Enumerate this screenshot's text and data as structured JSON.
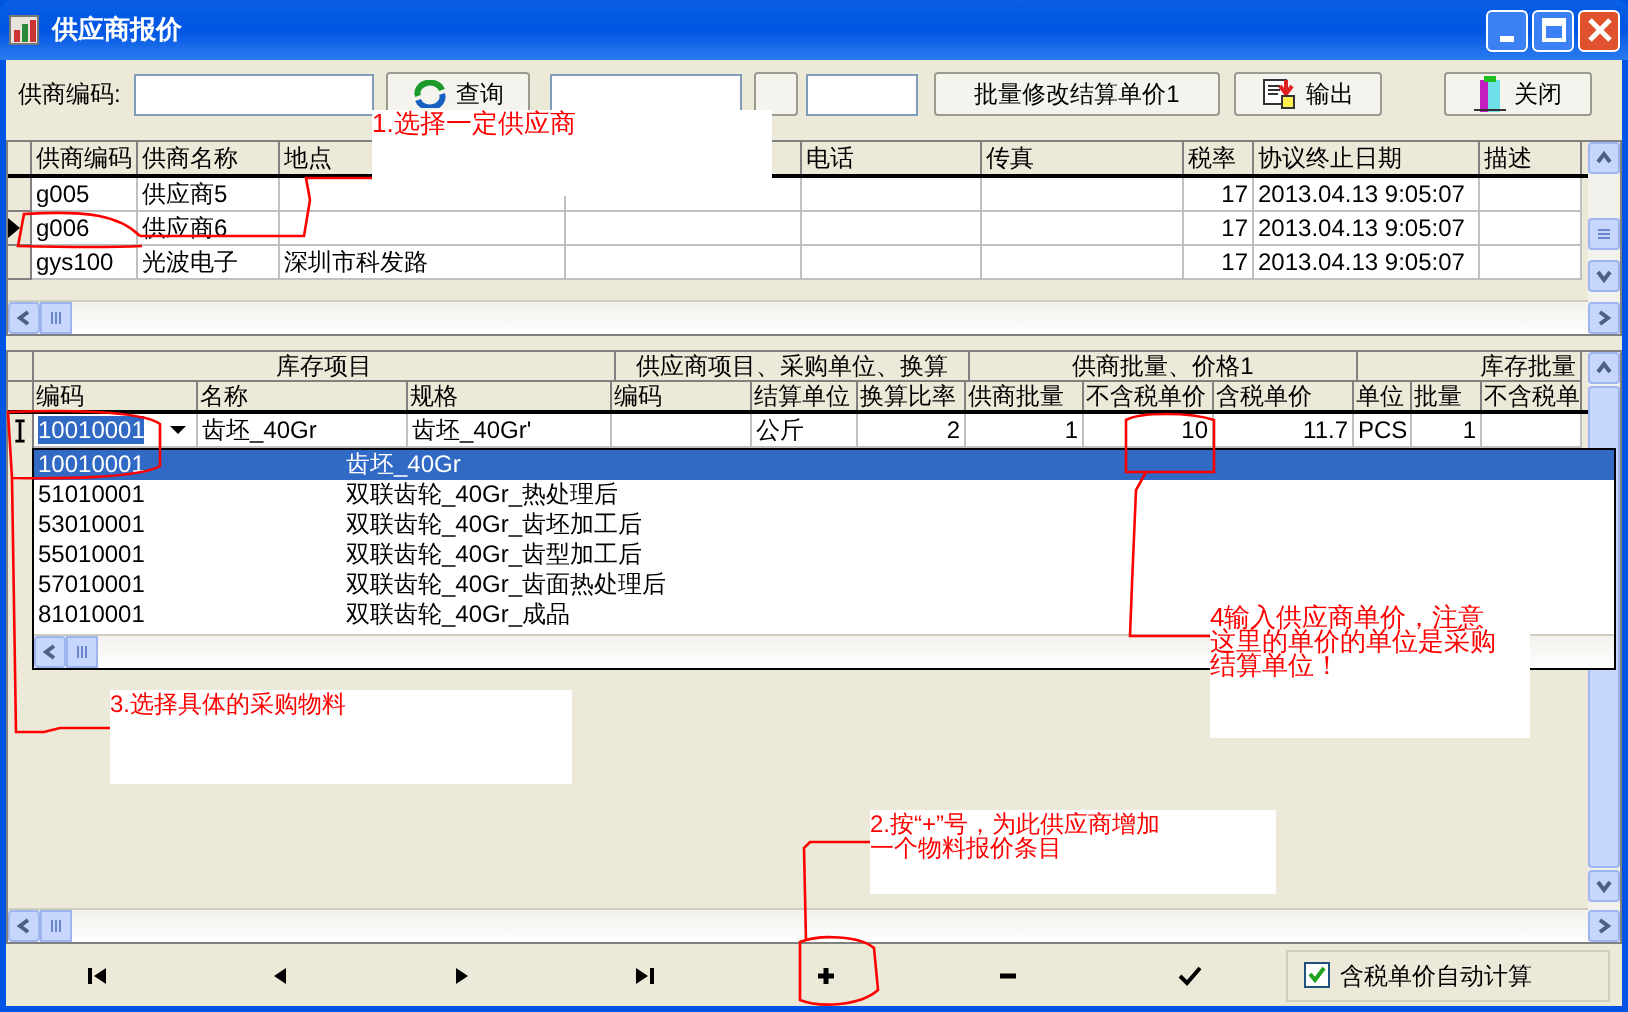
{
  "window": {
    "title": "供应商报价"
  },
  "toolbar": {
    "supplier_code_label": "供商编码:",
    "query_button": "查询",
    "batch_button": "批量修改结算单价1",
    "export_button": "输出",
    "close_button": "关闭"
  },
  "supplier_grid": {
    "columns": [
      {
        "label": "供商编码"
      },
      {
        "label": "供商名称"
      },
      {
        "label": "地点"
      },
      {},
      {
        "label": "电话"
      },
      {
        "label": "传真"
      },
      {
        "label": "税率"
      },
      {
        "label": "协议终止日期"
      },
      {
        "label": "描述"
      }
    ],
    "rows": [
      {
        "code": "g005",
        "name": "供应商5",
        "tax_rate": "17",
        "end_date": "2013.04.13 9:05:07",
        "selected": false
      },
      {
        "code": "g006",
        "name": "供应商6",
        "tax_rate": "17",
        "end_date": "2013.04.13 9:05:07",
        "selected": true
      },
      {
        "code": "gys100",
        "name": "光波电子",
        "location": "深圳市科发路",
        "tax_rate": "17",
        "end_date": "2013.04.13 9:05:07",
        "selected": false
      }
    ]
  },
  "quote_grid": {
    "groups": [
      "库存项目",
      "供应商项目、采购单位、换算",
      "供商批量、价格1",
      "库存批量"
    ],
    "columns": [
      "编码",
      "名称",
      "规格",
      "编码",
      "结算单位",
      "换算比率",
      "供商批量",
      "不含税单价",
      "含税单价",
      "单位",
      "批量",
      "不含税单"
    ],
    "row": {
      "code": "10010001",
      "name": "齿坯_40Gr",
      "spec": "齿坯_40Gr'",
      "settle_unit": "公斤",
      "ratio": "2",
      "supplier_qty": "1",
      "price_ex_tax": "10",
      "price_inc_tax": "11.7",
      "unit": "PCS",
      "qty": "1"
    }
  },
  "dropdown": [
    {
      "code": "10010001",
      "name": "齿坯_40Gr",
      "selected": true
    },
    {
      "code": "51010001",
      "name": "双联齿轮_40Gr_热处理后",
      "selected": false
    },
    {
      "code": "53010001",
      "name": "双联齿轮_40Gr_齿坯加工后",
      "selected": false
    },
    {
      "code": "55010001",
      "name": "双联齿轮_40Gr_齿型加工后",
      "selected": false
    },
    {
      "code": "57010001",
      "name": "双联齿轮_40Gr_齿面热处理后",
      "selected": false
    },
    {
      "code": "81010001",
      "name": "双联齿轮_40Gr_成品",
      "selected": false
    }
  ],
  "auto_calc": {
    "label": "含税单价自动计算",
    "checked": true
  },
  "annotations": [
    {
      "lines": [
        "1.选择一定供应商"
      ]
    },
    {
      "lines": [
        "3.选择具体的采购物料"
      ]
    },
    {
      "lines": [
        "2.按“+”号，为此供应商增加",
        "一个物料报价条目"
      ]
    },
    {
      "lines": [
        "4输入供应商单价，注意",
        "这里的单价的单位是采购",
        "结算单位！"
      ]
    }
  ]
}
